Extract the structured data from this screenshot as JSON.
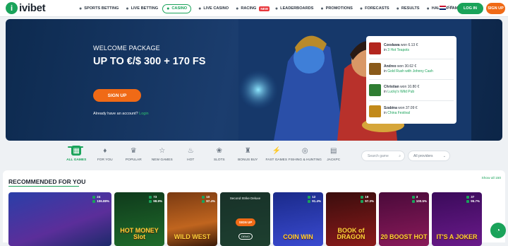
{
  "brand": {
    "name": "ivibet",
    "mark": "i"
  },
  "nav": [
    {
      "label": "SPORTS BETTING",
      "icon": "soccer-ball-icon"
    },
    {
      "label": "LIVE BETTING",
      "icon": "live-icon"
    },
    {
      "label": "CASINO",
      "icon": "casino-icon",
      "active": true
    },
    {
      "label": "LIVE CASINO",
      "icon": "cards-icon"
    },
    {
      "label": "RACING",
      "icon": "horse-icon",
      "badge": "NEW"
    },
    {
      "label": "LEADERBOARDS",
      "icon": "chart-icon"
    },
    {
      "label": "PROMOTIONS",
      "icon": "gift-icon"
    },
    {
      "label": "FORECASTS",
      "icon": "forecast-icon"
    },
    {
      "label": "RESULTS",
      "icon": "results-icon"
    },
    {
      "label": "HALL OF FAME",
      "icon": "trophy-icon"
    }
  ],
  "header": {
    "lang": "EN",
    "login": "LOG IN",
    "signup": "SIGN UP"
  },
  "hero": {
    "subtitle": "WELCOME PACKAGE",
    "title": "UP TO €/$ 300 + 170 FS",
    "cta": "SIGN UP",
    "account_text": "Already have an account?",
    "account_link": "Login"
  },
  "wins": [
    {
      "player": "Czesława",
      "won": "won 6.13 €",
      "game": "3 Hot Teapots",
      "color": "#b3261e"
    },
    {
      "player": "Andreo",
      "won": "won 30.62 €",
      "game": "Gold Rush with Johnny Cash",
      "color": "#8a5a1a"
    },
    {
      "player": "Christian",
      "won": "won 10.80 €",
      "game": "Lucky's Wild Pub",
      "color": "#2e7d32"
    },
    {
      "player": "Szabina",
      "won": "won 37.09 €",
      "game": "China Festival",
      "color": "#c28a1a"
    }
  ],
  "categories": [
    {
      "label": "ALL GAMES",
      "icon": "grid-icon",
      "glyph": "▦",
      "active": true
    },
    {
      "label": "FOR YOU",
      "icon": "diamond-icon",
      "glyph": "♦"
    },
    {
      "label": "POPULAR",
      "icon": "crown-icon",
      "glyph": "♛"
    },
    {
      "label": "NEW GAMES",
      "icon": "star-icon",
      "glyph": "☆"
    },
    {
      "label": "HOT",
      "icon": "flame-icon",
      "glyph": "♨"
    },
    {
      "label": "SLOTS",
      "icon": "cherry-icon",
      "glyph": "❀"
    },
    {
      "label": "BONUS BUY",
      "icon": "money-bag-icon",
      "glyph": "♜"
    },
    {
      "label": "FAST GAMES",
      "icon": "lightning-icon",
      "glyph": "⚡"
    },
    {
      "label": "FISHING & HUNTING",
      "icon": "target-icon",
      "glyph": "◎"
    },
    {
      "label": "JACKPC",
      "icon": "jackpot-icon",
      "glyph": "▤"
    }
  ],
  "search": {
    "placeholder": "Search game"
  },
  "providers": {
    "label": "All providers"
  },
  "section": {
    "title": "RECOMMENDED FOR YOU",
    "show_all": "Show all 150"
  },
  "games": [
    {
      "name": "",
      "players": "24",
      "rtp": "106.88%",
      "bg": "linear-gradient(160deg,#2a3fa8,#5b2e9a 60%,#1c2a6a)",
      "wide": true
    },
    {
      "name": "HOT MONEY Slot",
      "players": "73",
      "rtp": "98.9%",
      "bg": "linear-gradient(170deg,#0f3a1c,#1f6b2a)"
    },
    {
      "name": "WILD WEST",
      "players": "10",
      "rtp": "97.4%",
      "bg": "linear-gradient(170deg,#7a3a12,#c0651f 60%,#3a1a08)"
    },
    {
      "name": "",
      "hover": true,
      "hover_text": "Second Strike Deluxe",
      "play": "SIGN UP",
      "demo": "DEMO",
      "bg": "linear-gradient(170deg,#1d4a2a,#2a6a3a)"
    },
    {
      "name": "COIN WIN",
      "players": "12",
      "rtp": "91.4%",
      "bg": "linear-gradient(170deg,#1a2a8a,#3a4ad0)"
    },
    {
      "name": "BOOK of DRAGON",
      "players": "19",
      "rtp": "97.3%",
      "bg": "linear-gradient(170deg,#3a0d0d,#8a1a1a)"
    },
    {
      "name": "20 BOOST HOT",
      "players": "3",
      "rtp": "100.5%",
      "bg": "linear-gradient(170deg,#4a0a3a,#8a1a5a)"
    },
    {
      "name": "IT'S A JOKER",
      "players": "37",
      "rtp": "95.7%",
      "bg": "linear-gradient(170deg,#3a0a5a,#6a1a8a)"
    }
  ]
}
